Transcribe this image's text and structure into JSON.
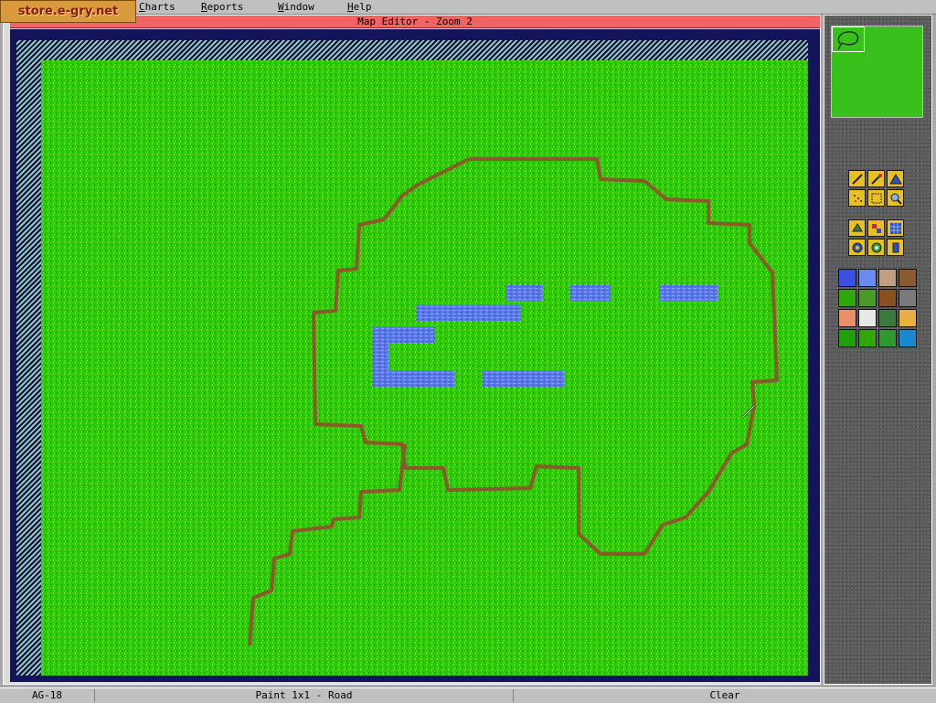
{
  "logo": {
    "text": "store.e-gry.net"
  },
  "menu": {
    "charts": {
      "acc": "C",
      "rest": "harts"
    },
    "reports": {
      "acc": "R",
      "rest": "eports"
    },
    "window": {
      "acc": "W",
      "rest": "indow"
    },
    "help": {
      "acc": "H",
      "rest": "elp"
    }
  },
  "window": {
    "title": "Map Editor - Zoom 2"
  },
  "tools": [
    {
      "name": "pencil-icon"
    },
    {
      "name": "brush-icon"
    },
    {
      "name": "fill-icon"
    },
    {
      "name": "spray-icon"
    },
    {
      "name": "select-rect-icon"
    },
    {
      "name": "zoom-icon"
    },
    {
      "name": "dig-icon"
    },
    {
      "name": "stamp-icon"
    },
    {
      "name": "grid-icon"
    },
    {
      "name": "target-icon"
    },
    {
      "name": "center-icon"
    },
    {
      "name": "object-icon"
    }
  ],
  "palette": [
    {
      "name": "water-tile",
      "color": "#3b4fe0"
    },
    {
      "name": "shallow-water-tile",
      "color": "#6a8af0"
    },
    {
      "name": "town-tile",
      "color": "#c0a080"
    },
    {
      "name": "settlement-tile",
      "color": "#8a5a30"
    },
    {
      "name": "grass-tile",
      "color": "#2ea80c"
    },
    {
      "name": "bush-tile",
      "color": "#4a9a2a"
    },
    {
      "name": "dirt-tile",
      "color": "#8a5020"
    },
    {
      "name": "rocks-tile",
      "color": "#7a7a7a"
    },
    {
      "name": "sand-tile",
      "color": "#e8906a"
    },
    {
      "name": "snow-tile",
      "color": "#e8e8e8"
    },
    {
      "name": "forest-tile",
      "color": "#3a7a3a"
    },
    {
      "name": "desert-tile",
      "color": "#e8b040"
    },
    {
      "name": "plain-tile",
      "color": "#1fa00a"
    },
    {
      "name": "road-tile",
      "color": "#2ea80c"
    },
    {
      "name": "river-tile",
      "color": "#2e9a2e"
    },
    {
      "name": "coast-tile",
      "color": "#1a8ad0"
    }
  ],
  "status": {
    "coord": "AG-18",
    "mode": "Paint 1x1 - Road",
    "action": "Clear"
  },
  "colors": {
    "grass": "#2ec80c",
    "road": "#8a5a2a",
    "water": "#5a78e8",
    "title": "#f26464"
  }
}
